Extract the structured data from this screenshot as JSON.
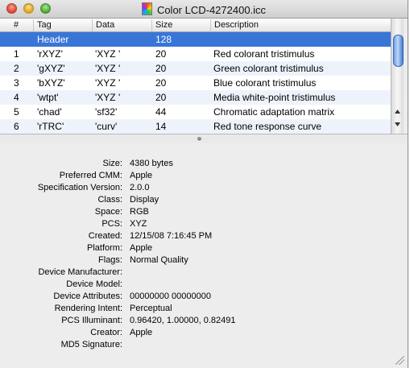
{
  "window": {
    "title": "Color LCD-4272400.icc"
  },
  "table": {
    "columns": [
      "#",
      "Tag",
      "Data",
      "Size",
      "Description"
    ],
    "rows": [
      {
        "num": "",
        "tag": "Header",
        "data": "",
        "size": "128",
        "desc": "",
        "selected": true
      },
      {
        "num": "1",
        "tag": "'rXYZ'",
        "data": "'XYZ '",
        "size": "20",
        "desc": "Red colorant tristimulus"
      },
      {
        "num": "2",
        "tag": "'gXYZ'",
        "data": "'XYZ '",
        "size": "20",
        "desc": "Green colorant tristimulus"
      },
      {
        "num": "3",
        "tag": "'bXYZ'",
        "data": "'XYZ '",
        "size": "20",
        "desc": "Blue colorant tristimulus"
      },
      {
        "num": "4",
        "tag": "'wtpt'",
        "data": "'XYZ '",
        "size": "20",
        "desc": "Media white-point tristimulus"
      },
      {
        "num": "5",
        "tag": "'chad'",
        "data": "'sf32'",
        "size": "44",
        "desc": "Chromatic adaptation matrix"
      },
      {
        "num": "6",
        "tag": "'rTRC'",
        "data": "'curv'",
        "size": "14",
        "desc": "Red tone response curve"
      }
    ]
  },
  "details": [
    {
      "label": "Size:",
      "value": "4380 bytes"
    },
    {
      "label": "Preferred CMM:",
      "value": "Apple"
    },
    {
      "label": "Specification Version:",
      "value": "2.0.0"
    },
    {
      "label": "Class:",
      "value": "Display"
    },
    {
      "label": "Space:",
      "value": "RGB"
    },
    {
      "label": "PCS:",
      "value": "XYZ"
    },
    {
      "label": "Created:",
      "value": "12/15/08 7:16:45 PM"
    },
    {
      "label": "Platform:",
      "value": "Apple"
    },
    {
      "label": "Flags:",
      "value": "Normal Quality"
    },
    {
      "label": "Device Manufacturer:",
      "value": ""
    },
    {
      "label": "Device Model:",
      "value": ""
    },
    {
      "label": "Device Attributes:",
      "value": "00000000 00000000"
    },
    {
      "label": "Rendering Intent:",
      "value": "Perceptual"
    },
    {
      "label": "PCS Illuminant:",
      "value": "0.96420, 1.00000, 0.82491"
    },
    {
      "label": "Creator:",
      "value": "Apple"
    },
    {
      "label": "MD5 Signature:",
      "value": ""
    }
  ],
  "colors": {
    "selection": "#3875d7",
    "alt_row": "#eef3fb",
    "window_bg": "#ededed"
  },
  "icons": {
    "close": "close-button-red",
    "minimize": "minimize-button-yellow",
    "zoom": "zoom-button-green",
    "document": "color-profile-icon"
  }
}
